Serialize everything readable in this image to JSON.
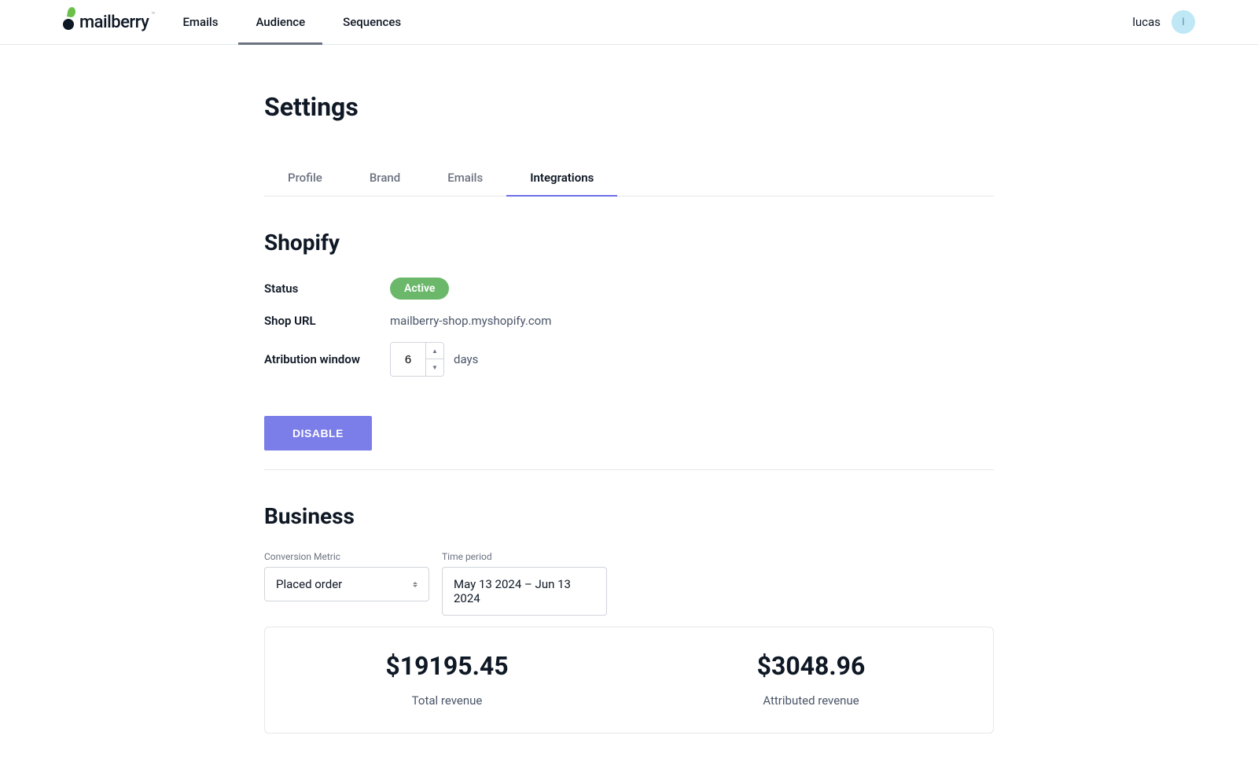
{
  "header": {
    "logo_text": "mailberry",
    "nav": [
      {
        "label": "Emails"
      },
      {
        "label": "Audience"
      },
      {
        "label": "Sequences"
      }
    ],
    "user_name": "lucas",
    "user_initial": "l"
  },
  "page": {
    "title": "Settings",
    "tabs": [
      {
        "label": "Profile"
      },
      {
        "label": "Brand"
      },
      {
        "label": "Emails"
      },
      {
        "label": "Integrations"
      }
    ]
  },
  "shopify": {
    "section_title": "Shopify",
    "status_label": "Status",
    "status_value": "Active",
    "url_label": "Shop URL",
    "url_value": "mailberry-shop.myshopify.com",
    "attr_label": "Atribution window",
    "attr_value": "6",
    "attr_unit": "days",
    "disable_label": "DISABLE"
  },
  "business": {
    "section_title": "Business",
    "metric_label": "Conversion Metric",
    "metric_value": "Placed order",
    "period_label": "Time period",
    "period_value": "May 13 2024 – Jun 13 2024",
    "total_revenue_value": "$19195.45",
    "total_revenue_label": "Total revenue",
    "attributed_revenue_value": "$3048.96",
    "attributed_revenue_label": "Attributed revenue"
  }
}
